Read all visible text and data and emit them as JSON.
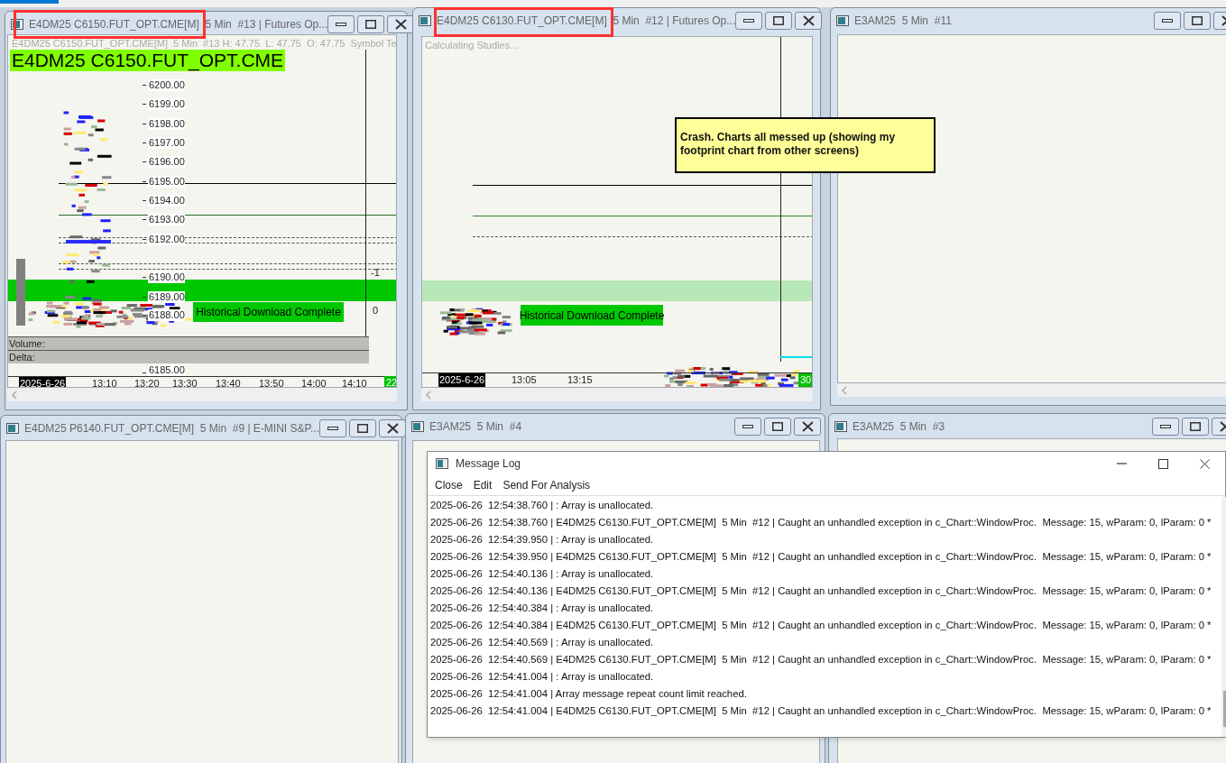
{
  "charts": [
    {
      "kind": "footprint",
      "title": "E4DM25 C6150.FUT_OPT.CME[M]  5 Min  #13 | Futures Op...",
      "highlighted": true,
      "info_line": "E4DM25 C6150.FUT_OPT.CME[M]  5 Min  #13 H: 47.75  L: 47.75  O: 47.75  Symbol Te",
      "symbol_label": "E4DM25 C6150.FUT_OPT.CME",
      "price_labels": [
        "6200.00",
        "6199.00",
        "6198.00",
        "6197.00",
        "6196.00",
        "6195.00",
        "6194.00",
        "6193.00",
        "6192.00",
        "6190.00",
        "6189.00",
        "6188.00",
        "6185.00"
      ],
      "right_labels": [
        "-1",
        "0"
      ],
      "banner": "Historical Download Complete",
      "panels": [
        "Volume:",
        "Delta:"
      ],
      "date_label": "2025-6-26",
      "time_labels": [
        "13:10",
        "13:20",
        "13:30",
        "13:40",
        "13:50",
        "14:00",
        "14:10"
      ],
      "badge": "22"
    },
    {
      "kind": "footprint",
      "title": "E4DM25 C6130.FUT_OPT.CME[M]  5 Min  #12 | Futures Op...",
      "highlighted": true,
      "info_line": "Calculating Studies...",
      "banner": "Historical Download Complete",
      "date_label": "2025-6-26",
      "time_labels": [
        "13:05",
        "13:15"
      ],
      "badge": "30"
    },
    {
      "kind": "empty",
      "title": "E3AM25  5 Min  #11",
      "highlighted": false
    },
    {
      "kind": "empty",
      "title": "E4DM25 P6140.FUT_OPT.CME[M]  5 Min  #9 | E-MINI S&P...",
      "highlighted": false
    },
    {
      "kind": "empty",
      "title": "E3AM25  5 Min  #4",
      "highlighted": false
    },
    {
      "kind": "empty",
      "title": "E3AM25  5 Min  #3",
      "highlighted": false
    }
  ],
  "note": "Crash. Charts all messed up (showing my footprint chart from other screens)",
  "message_log": {
    "title": "Message Log",
    "menu": [
      "Close",
      "Edit",
      "Send For Analysis"
    ],
    "lines": [
      "2025-06-26  12:54:38.760 | : Array is unallocated.",
      "2025-06-26  12:54:38.760 | E4DM25 C6130.FUT_OPT.CME[M]  5 Min  #12 | Caught an unhandled exception in c_Chart::WindowProc.  Message: 15, wParam: 0, lParam: 0 *",
      "2025-06-26  12:54:39.950 | : Array is unallocated.",
      "2025-06-26  12:54:39.950 | E4DM25 C6130.FUT_OPT.CME[M]  5 Min  #12 | Caught an unhandled exception in c_Chart::WindowProc.  Message: 15, wParam: 0, lParam: 0 *",
      "2025-06-26  12:54:40.136 | : Array is unallocated.",
      "2025-06-26  12:54:40.136 | E4DM25 C6130.FUT_OPT.CME[M]  5 Min  #12 | Caught an unhandled exception in c_Chart::WindowProc.  Message: 15, wParam: 0, lParam: 0 *",
      "2025-06-26  12:54:40.384 | : Array is unallocated.",
      "2025-06-26  12:54:40.384 | E4DM25 C6130.FUT_OPT.CME[M]  5 Min  #12 | Caught an unhandled exception in c_Chart::WindowProc.  Message: 15, wParam: 0, lParam: 0 *",
      "2025-06-26  12:54:40.569 | : Array is unallocated.",
      "2025-06-26  12:54:40.569 | E4DM25 C6130.FUT_OPT.CME[M]  5 Min  #12 | Caught an unhandled exception in c_Chart::WindowProc.  Message: 15, wParam: 0, lParam: 0 *",
      "2025-06-26  12:54:41.004 | : Array is unallocated.",
      "2025-06-26  12:54:41.004 | Array message repeat count limit reached.",
      "2025-06-26  12:54:41.004 | E4DM25 C6130.FUT_OPT.CME[M]  5 Min  #12 | Caught an unhandled exception in c_Chart::WindowProc.  Message: 15, wParam: 0, lParam: 0 *"
    ]
  }
}
